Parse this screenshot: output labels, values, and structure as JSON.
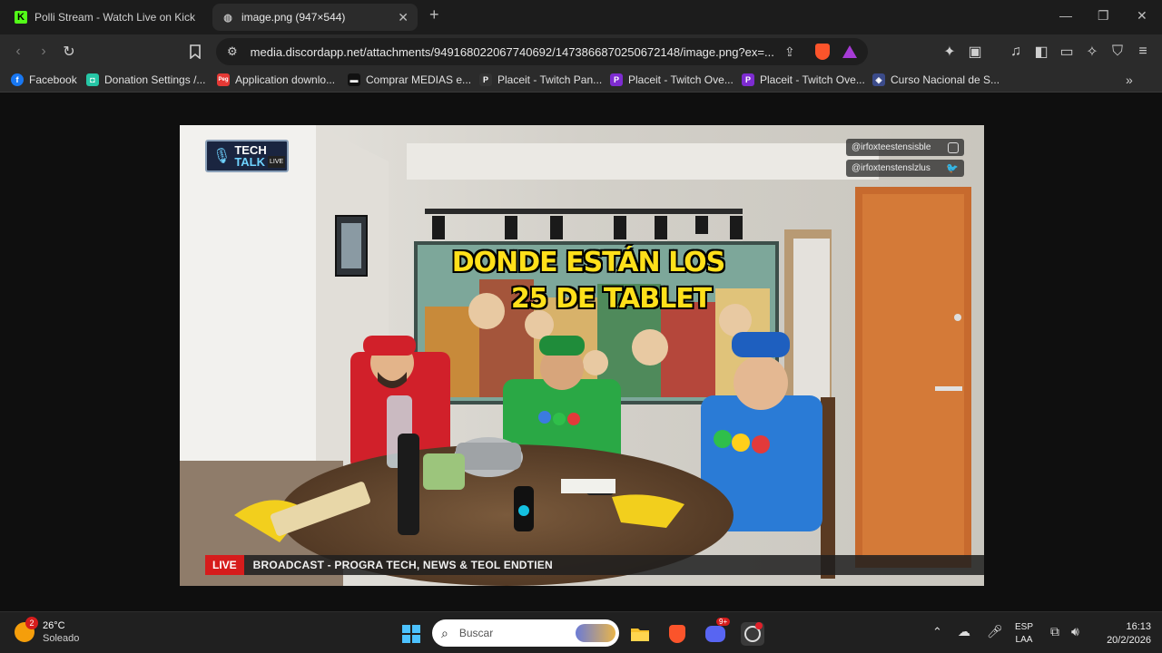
{
  "tabs": [
    {
      "label": "Polli Stream - Watch Live on Kick",
      "favicon": "K"
    },
    {
      "label": "image.png (947×544)"
    }
  ],
  "address_bar": {
    "url": "media.discordapp.net/attachments/949168022067740692/1473866870250672148/image.png?ex=..."
  },
  "bookmarks": [
    {
      "label": "Facebook",
      "icon": "facebook-icon",
      "color": "#1877f2",
      "glyph": "f"
    },
    {
      "label": "Donation Settings /...",
      "icon": "donation-icon",
      "color": "#26c6a6",
      "glyph": "◘"
    },
    {
      "label": "Application downlo...",
      "icon": "peg-icon",
      "color": "#e53935",
      "glyph": "Peg"
    },
    {
      "label": "Comprar MEDIAS e...",
      "icon": "medias-icon",
      "color": "#111111",
      "glyph": "▬"
    },
    {
      "label": "Placeit - Twitch Pan...",
      "icon": "placeit-icon",
      "color": "#333333",
      "glyph": "P"
    },
    {
      "label": "Placeit - Twitch Ove...",
      "icon": "placeit-icon",
      "color": "#7e2cd1",
      "glyph": "P"
    },
    {
      "label": "Placeit - Twitch Ove...",
      "icon": "placeit-icon",
      "color": "#7e2cd1",
      "glyph": "P"
    },
    {
      "label": "Curso Nacional de S...",
      "icon": "curso-icon",
      "color": "#3b4b8a",
      "glyph": "◈"
    }
  ],
  "stream": {
    "logo_line1": "TECH",
    "logo_line2": "TALK",
    "logo_badge": "LIVE",
    "social_1": "@irfoxteestensisble",
    "social_2": "@irfoxtenstenslzlus",
    "headline_line1": "DONDE ESTÁN LOS",
    "headline_line2": "25 DE TABLET",
    "live_badge": "LIVE",
    "ticker": "BROADCAST - PROGRA TECH, NEWS & TEOL ENDTIEN"
  },
  "taskbar": {
    "weather_temp": "26°C",
    "weather_desc": "Soleado",
    "weather_badge": "2",
    "search_placeholder": "Buscar",
    "discord_badge": "9+",
    "lang_1": "ESP",
    "lang_2": "LAA",
    "time": "16:13",
    "date": "20/2/2026"
  }
}
